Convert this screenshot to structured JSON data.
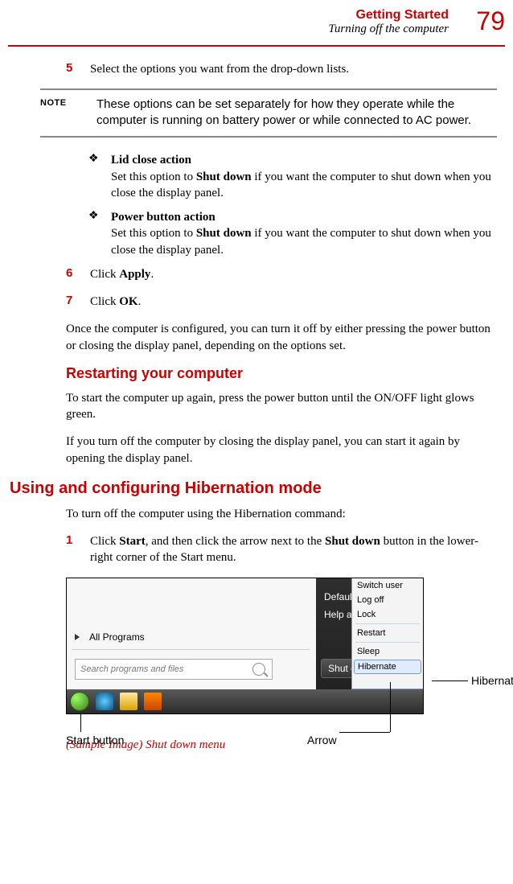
{
  "header": {
    "title": "Getting Started",
    "subtitle": "Turning off the computer",
    "page_number": "79"
  },
  "step5": {
    "num": "5",
    "text": "Select the options you want from the drop-down lists."
  },
  "note": {
    "label": "NOTE",
    "text": "These options can be set separately for how they operate while the computer is running on battery power or while connected to AC power."
  },
  "bullet1": {
    "title": "Lid close action",
    "text_a": "Set this option to ",
    "text_bold": "Shut down",
    "text_b": " if you want the computer to shut down when you close the display panel."
  },
  "bullet2": {
    "title": "Power button action",
    "text_a": "Set this option to ",
    "text_bold": "Shut down",
    "text_b": " if you want the computer to shut down when you close the display panel."
  },
  "step6": {
    "num": "6",
    "text_a": "Click ",
    "text_bold": "Apply",
    "text_b": "."
  },
  "step7": {
    "num": "7",
    "text_a": "Click ",
    "text_bold": "OK",
    "text_b": "."
  },
  "para_after": "Once the computer is configured, you can turn it off by either pressing the power button or closing the display panel, depending on the options set.",
  "h2_restart": "Restarting your computer",
  "para_restart1": "To start the computer up again, press the power button until the ON/OFF light glows green.",
  "para_restart2": "If you turn off the computer by closing the display panel, you can start it again by opening the display panel.",
  "h1_hibernate": "Using and configuring Hibernation mode",
  "para_hib_intro": "To turn off the computer using the Hibernation command:",
  "step1_hib": {
    "num": "1",
    "t1": "Click ",
    "b1": "Start",
    "t2": ", and then click the arrow next to the ",
    "b2": "Shut down",
    "t3": " button in the lower-right corner of the Start menu."
  },
  "figure": {
    "all_programs": "All Programs",
    "search_placeholder": "Search programs and files",
    "default_programs": "Default Programs",
    "help_support": "Help and Support",
    "shutdown": "Shut down",
    "menu": {
      "switch_user": "Switch user",
      "log_off": "Log off",
      "lock": "Lock",
      "restart": "Restart",
      "sleep": "Sleep",
      "hibernate": "Hibernate"
    }
  },
  "callouts": {
    "start": "Start button",
    "arrow": "Arrow",
    "hibernate": "Hibernate"
  },
  "caption": "(Sample Image) Shut down menu"
}
